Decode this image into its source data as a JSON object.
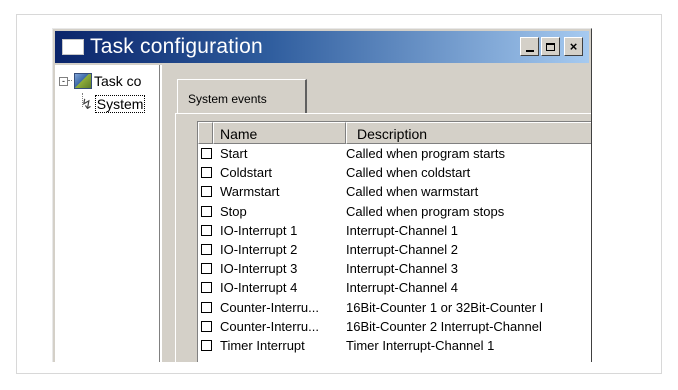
{
  "window": {
    "title": "Task configuration",
    "controls": {
      "minimize": "_",
      "maximize": "□",
      "close": "×"
    }
  },
  "tree": {
    "root_label": "Task co",
    "root_expander": "-",
    "child_label": "System"
  },
  "tabs": [
    {
      "label": "System events"
    }
  ],
  "table": {
    "columns": [
      "Name",
      "Description"
    ],
    "rows": [
      {
        "name": "Start",
        "description": "Called when program starts"
      },
      {
        "name": "Coldstart",
        "description": "Called when coldstart"
      },
      {
        "name": "Warmstart",
        "description": "Called when warmstart"
      },
      {
        "name": "Stop",
        "description": "Called when program stops"
      },
      {
        "name": "IO-Interrupt 1",
        "description": "Interrupt-Channel 1"
      },
      {
        "name": "IO-Interrupt 2",
        "description": "Interrupt-Channel 2"
      },
      {
        "name": "IO-Interrupt 3",
        "description": "Interrupt-Channel 3"
      },
      {
        "name": "IO-Interrupt 4",
        "description": "Interrupt-Channel 4"
      },
      {
        "name": "Counter-Interru...",
        "description": "16Bit-Counter 1 or 32Bit-Counter I"
      },
      {
        "name": "Counter-Interru...",
        "description": "16Bit-Counter 2 Interrupt-Channel"
      },
      {
        "name": "Timer Interrupt",
        "description": "Timer Interrupt-Channel 1"
      }
    ]
  }
}
